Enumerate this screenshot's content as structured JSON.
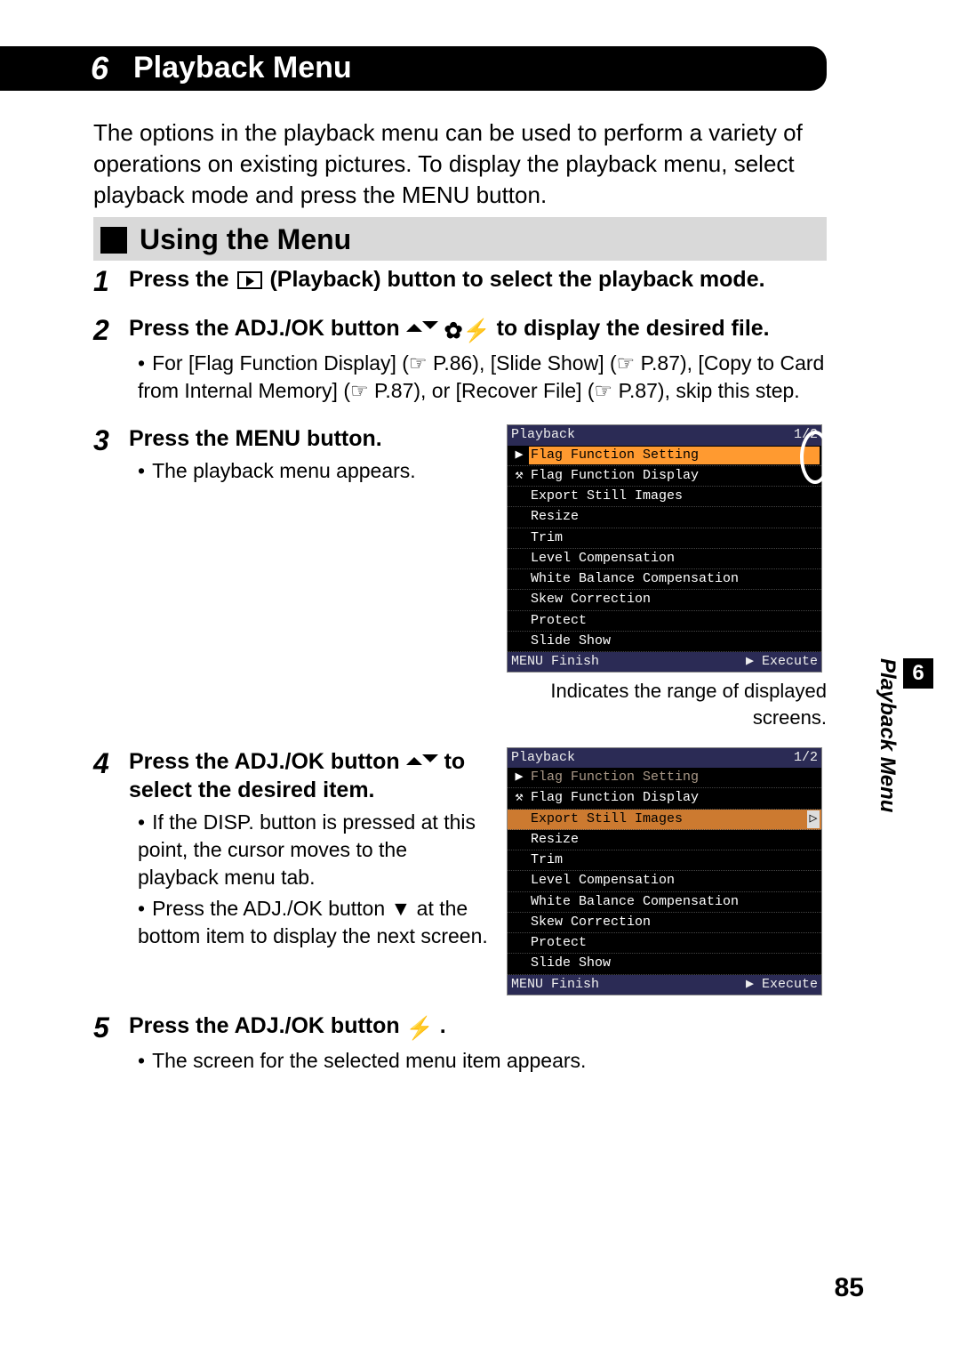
{
  "chapter": {
    "num": "6",
    "title": "Playback Menu"
  },
  "intro": "The options in the playback menu can be used to perform a variety of operations on existing pictures. To display the playback menu, select playback mode and press the MENU button.",
  "section_heading": "Using the Menu",
  "steps": [
    {
      "num": "1",
      "head_parts": [
        "Press the ",
        " (Playback) button to select the playback mode."
      ]
    },
    {
      "num": "2",
      "head_parts": [
        "Press the ADJ./OK button ",
        " to display the desired file."
      ],
      "bullets": [
        "For [Flag Function Display] (☞ P.86), [Slide Show] (☞ P.87), [Copy to Card from Internal Memory] (☞ P.87), or [Recover File] (☞ P.87), skip this step."
      ]
    },
    {
      "num": "3",
      "head": "Press the MENU button.",
      "bullets": [
        "The playback menu appears."
      ]
    },
    {
      "num": "4",
      "head_parts": [
        "Press the ADJ./OK button ",
        " to select the desired item."
      ],
      "bullets": [
        "If the DISP. button is pressed at this point, the cursor moves to the playback menu tab.",
        "Press the ADJ./OK button ▼ at the bottom item to display the next screen."
      ]
    },
    {
      "num": "5",
      "head_parts": [
        "Press the ADJ./OK button ",
        "."
      ],
      "bullets": [
        "The screen for the selected menu item appears."
      ]
    }
  ],
  "menu1": {
    "title": "Playback",
    "page": "1/2",
    "items": [
      "Flag Function Setting",
      "Flag Function Display",
      "Export Still Images",
      "Resize",
      "Trim",
      "Level Compensation",
      "White Balance Compensation",
      "Skew Correction",
      "Protect",
      "Slide Show"
    ],
    "footer_left": "MENU Finish",
    "footer_right": "Execute",
    "caption": "Indicates the range of displayed screens."
  },
  "menu2": {
    "title": "Playback",
    "page": "1/2",
    "items": [
      "Flag Function Setting",
      "Flag Function Display",
      "Export Still Images",
      "Resize",
      "Trim",
      "Level Compensation",
      "White Balance Compensation",
      "Skew Correction",
      "Protect",
      "Slide Show"
    ],
    "footer_left": "MENU Finish",
    "footer_right": "Execute"
  },
  "side_tab": {
    "num": "6",
    "label": "Playback Menu"
  },
  "page_num": "85"
}
